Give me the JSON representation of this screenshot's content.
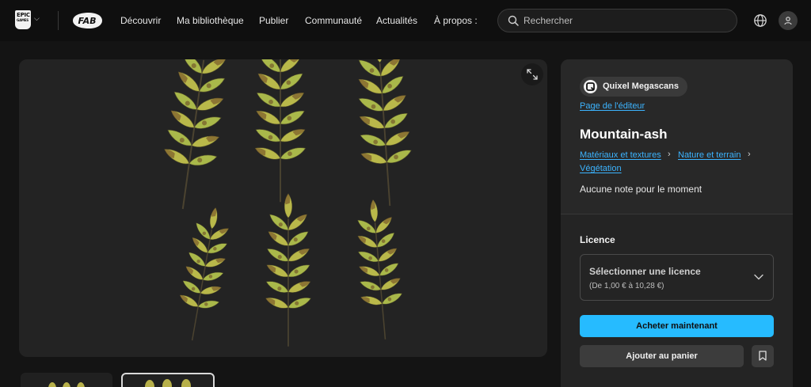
{
  "nav": {
    "epic_logo_text": "EPIC",
    "epic_logo_subtext": "GAMES",
    "fab_logo_text": "FAB",
    "links": [
      "Découvrir",
      "Ma bibliothèque",
      "Publier",
      "Communauté",
      "Actualités",
      "À propos :"
    ],
    "search_placeholder": "Rechercher",
    "icons": {
      "search": "search-icon",
      "language": "globe-icon",
      "account": "user-icon",
      "epic_menu": "chevron-down-icon"
    }
  },
  "gallery": {
    "image_subject": "Mountain-ash leaves",
    "expand_icon": "expand-icon",
    "thumbnail_count": 2,
    "selected_thumbnail": 2
  },
  "product": {
    "publisher": "Quixel Megascans",
    "publisher_page_link": "Page de l'éditeur",
    "title": "Mountain-ash",
    "breadcrumbs": [
      "Matériaux et textures",
      "Nature et terrain",
      "Végétation"
    ],
    "rating_text": "Aucune note pour le moment"
  },
  "licence": {
    "heading": "Licence",
    "select_title": "Sélectionner une licence",
    "price_range": "(De 1,00 € à 10,28 €)"
  },
  "actions": {
    "buy_label": "Acheter maintenant",
    "cart_label": "Ajouter au panier",
    "bookmark_icon": "bookmark-icon"
  },
  "colors": {
    "accent": "#26bbff",
    "link": "#3cb4ff",
    "background": "#141414",
    "panel": "#242424"
  }
}
